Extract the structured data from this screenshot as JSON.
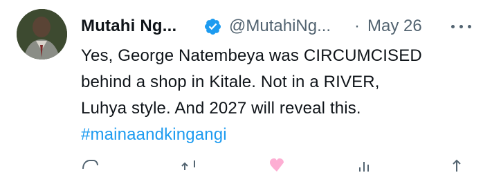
{
  "author": {
    "name": "Mutahi Ng...",
    "handle": "@MutahiNg...",
    "verified": true,
    "avatar_icon": "profile-photo"
  },
  "meta": {
    "separator": "·",
    "date": "May 26"
  },
  "body": {
    "lines": [
      "Yes, George Natembeya was CIRCUMCISED",
      "behind a shop in Kitale. Not in a RIVER,",
      "Luhya style. And 2027 will reveal this."
    ],
    "hashtag": "#mainaandkingangi"
  },
  "colors": {
    "text": "#0f1419",
    "secondary": "#536471",
    "link": "#1d9bf0",
    "verified_badge": "#1d9bf0",
    "like": "#f91880"
  },
  "actions": [
    "reply-icon",
    "retweet-icon",
    "like-icon",
    "views-icon",
    "share-icon"
  ]
}
